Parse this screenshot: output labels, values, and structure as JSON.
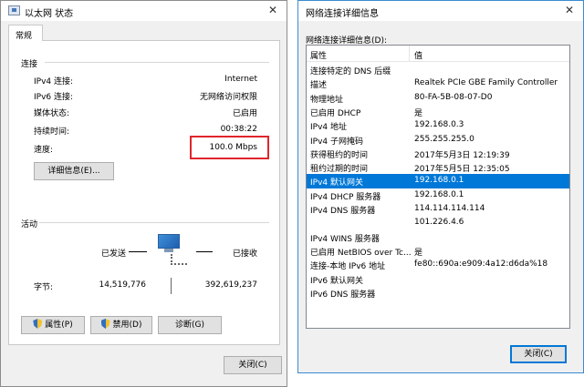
{
  "left_window": {
    "title": "以太网 状态",
    "close_glyph": "✕",
    "tab": "常规",
    "connection": {
      "heading": "连接",
      "rows": [
        {
          "label": "IPv4 连接:",
          "value": "Internet"
        },
        {
          "label": "IPv6 连接:",
          "value": "无网络访问权限"
        },
        {
          "label": "媒体状态:",
          "value": "已启用"
        },
        {
          "label": "持续时间:",
          "value": "00:38:22"
        },
        {
          "label": "速度:",
          "value": "100.0 Mbps"
        }
      ],
      "details_button": "详细信息(E)..."
    },
    "activity": {
      "heading": "活动",
      "sent_label": "已发送",
      "received_label": "已接收",
      "bytes_label": "字节:",
      "bytes_sent": "14,519,776",
      "bytes_received": "392,619,237"
    },
    "buttons": {
      "properties": "属性(P)",
      "disable": "禁用(D)",
      "diagnose": "诊断(G)",
      "close": "关闭(C)"
    }
  },
  "right_window": {
    "title": "网络连接详细信息",
    "close_glyph": "✕",
    "section_label": "网络连接详细信息(D):",
    "columns": {
      "property": "属性",
      "value": "值"
    },
    "rows": [
      {
        "property": "连接特定的 DNS 后缀",
        "value": ""
      },
      {
        "property": "描述",
        "value": "Realtek PCIe GBE Family Controller"
      },
      {
        "property": "物理地址",
        "value": "80-FA-5B-08-07-D0"
      },
      {
        "property": "已启用 DHCP",
        "value": "是"
      },
      {
        "property": "IPv4 地址",
        "value": "192.168.0.3"
      },
      {
        "property": "IPv4 子网掩码",
        "value": "255.255.255.0"
      },
      {
        "property": "获得租约的时间",
        "value": "2017年5月3日 12:19:39"
      },
      {
        "property": "租约过期的时间",
        "value": "2017年5月5日 12:35:05"
      },
      {
        "property": "IPv4 默认网关",
        "value": "192.168.0.1",
        "selected": true
      },
      {
        "property": "IPv4 DHCP 服务器",
        "value": "192.168.0.1"
      },
      {
        "property": "IPv4 DNS 服务器",
        "value": "114.114.114.114"
      },
      {
        "property": "",
        "value": "101.226.4.6"
      },
      {
        "property": "IPv4 WINS 服务器",
        "value": ""
      },
      {
        "property": "已启用 NetBIOS over Tc...",
        "value": "是"
      },
      {
        "property": "连接-本地 IPv6 地址",
        "value": "fe80::690a:e909:4a12:d6da%18"
      },
      {
        "property": "IPv6 默认网关",
        "value": ""
      },
      {
        "property": "IPv6 DNS 服务器",
        "value": ""
      }
    ],
    "close_button": "关闭(C)"
  },
  "colors": {
    "highlight_box": "#e0262b",
    "selection": "#0078d7"
  }
}
